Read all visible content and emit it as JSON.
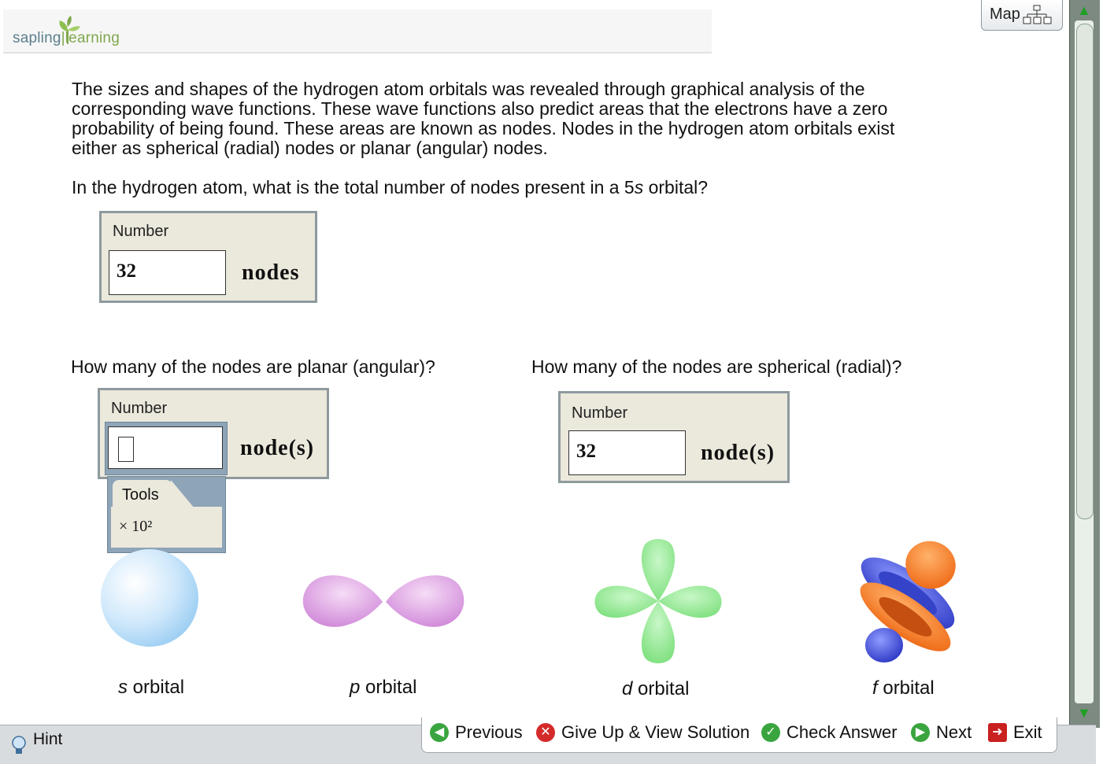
{
  "header": {
    "logo_left": "sapling",
    "logo_right": "learning"
  },
  "map": {
    "label": "Map",
    "icon": "sitemap-icon"
  },
  "question": {
    "intro_lines": [
      "The sizes and shapes of the hydrogen atom orbitals was revealed through graphical analysis of the",
      "corresponding wave functions.  These wave functions also predict areas that the electrons have a zero",
      "probability of being found. These areas are known as nodes. Nodes in the hydrogen atom orbitals exist",
      "either as spherical (radial) nodes or planar (angular) nodes."
    ],
    "prompt_before": "In the hydrogen atom, what is the total number of nodes present in a 5",
    "prompt_italic": "s",
    "prompt_after": " orbital?"
  },
  "answers": {
    "total": {
      "label": "Number",
      "value": "32",
      "unit": "nodes"
    },
    "planar_question": "How many of the nodes are planar (angular)?",
    "planar": {
      "label": "Number",
      "value": "",
      "unit": "node(s)"
    },
    "spherical_question": "How many of the nodes are spherical (radial)?",
    "spherical": {
      "label": "Number",
      "value": "32",
      "unit": "node(s)"
    }
  },
  "tools": {
    "label": "Tools",
    "item": "× 10²"
  },
  "orbitals": [
    {
      "letter": "s",
      "label": " orbital"
    },
    {
      "letter": "p",
      "label": " orbital"
    },
    {
      "letter": "d",
      "label": " orbital"
    },
    {
      "letter": "f",
      "label": " orbital"
    }
  ],
  "footer": {
    "hint": "Hint",
    "previous": "Previous",
    "give_up": "Give Up & View Solution",
    "check": "Check Answer",
    "next": "Next",
    "exit": "Exit"
  },
  "colors": {
    "accent_green": "#7ea84c",
    "box_bg": "#ebe8dc",
    "tools_blue": "#8ea4b7"
  }
}
